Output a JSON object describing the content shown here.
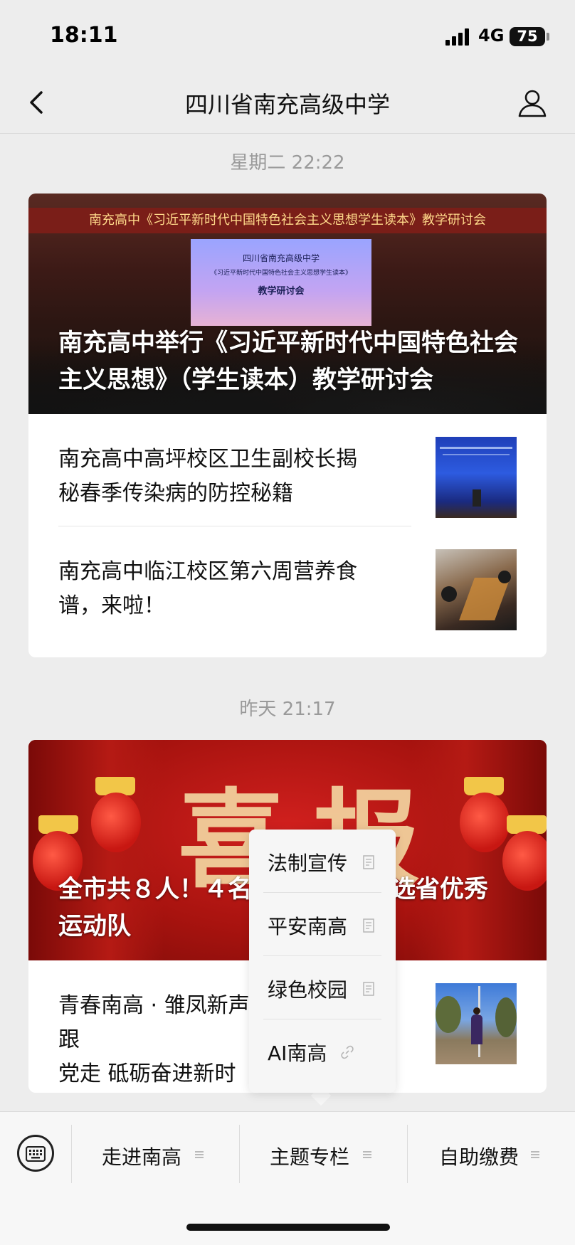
{
  "status_bar": {
    "time": "18:11",
    "network": "4G",
    "battery": "75"
  },
  "nav": {
    "title": "四川省南充高级中学",
    "back_icon": "chevron-left-icon",
    "profile_icon": "person-icon"
  },
  "groups": [
    {
      "timestamp": "星期二 22:22",
      "hero": {
        "title": "南充高中举行《习近平新时代中国特色社会主义思想》（学生读本）教学研讨会",
        "banner_text": "南充高中《习近平新时代中国特色社会主义思想学生读本》教学研讨会",
        "screen_lines": [
          "四川省南充高级中学",
          "《习近平新时代中国特色社会主义思想学生读本》",
          "教学研讨会"
        ]
      },
      "items": [
        {
          "title": "南充高中高坪校区卫生副校长揭秘春季传染病的防控秘籍"
        },
        {
          "title": "南充高中临江校区第六周营养食谱，来啦！"
        }
      ]
    },
    {
      "timestamp": "昨天 21:17",
      "hero": {
        "title": "全市共8人！4名……选省优秀运动队",
        "title_line1_left": "全市共８人！４名",
        "title_line1_right": "选省优秀",
        "title_line2": "运动队",
        "big_text": "喜报"
      },
      "items": [
        {
          "title_line1": "青春南高 · 雏凤新声",
          "title_line1_tail": "跟",
          "title_line2": "党走 砥砺奋进新时"
        }
      ]
    }
  ],
  "popup_menu": {
    "items": [
      {
        "label": "法制宣传",
        "icon": "article-icon"
      },
      {
        "label": "平安南高",
        "icon": "article-icon"
      },
      {
        "label": "绿色校园",
        "icon": "article-icon"
      },
      {
        "label": "AI南高",
        "icon": "link-icon"
      }
    ]
  },
  "bottom_menu": {
    "keyboard_icon": "keyboard-icon",
    "tabs": [
      {
        "label": "走进南高",
        "icon": "menu-lines-icon"
      },
      {
        "label": "主题专栏",
        "icon": "menu-lines-icon"
      },
      {
        "label": "自助缴费",
        "icon": "menu-lines-icon"
      }
    ]
  },
  "colors": {
    "background": "#ededed",
    "card": "#ffffff",
    "timestamp": "#9a9a9a",
    "popup": "#f6f6f6"
  }
}
